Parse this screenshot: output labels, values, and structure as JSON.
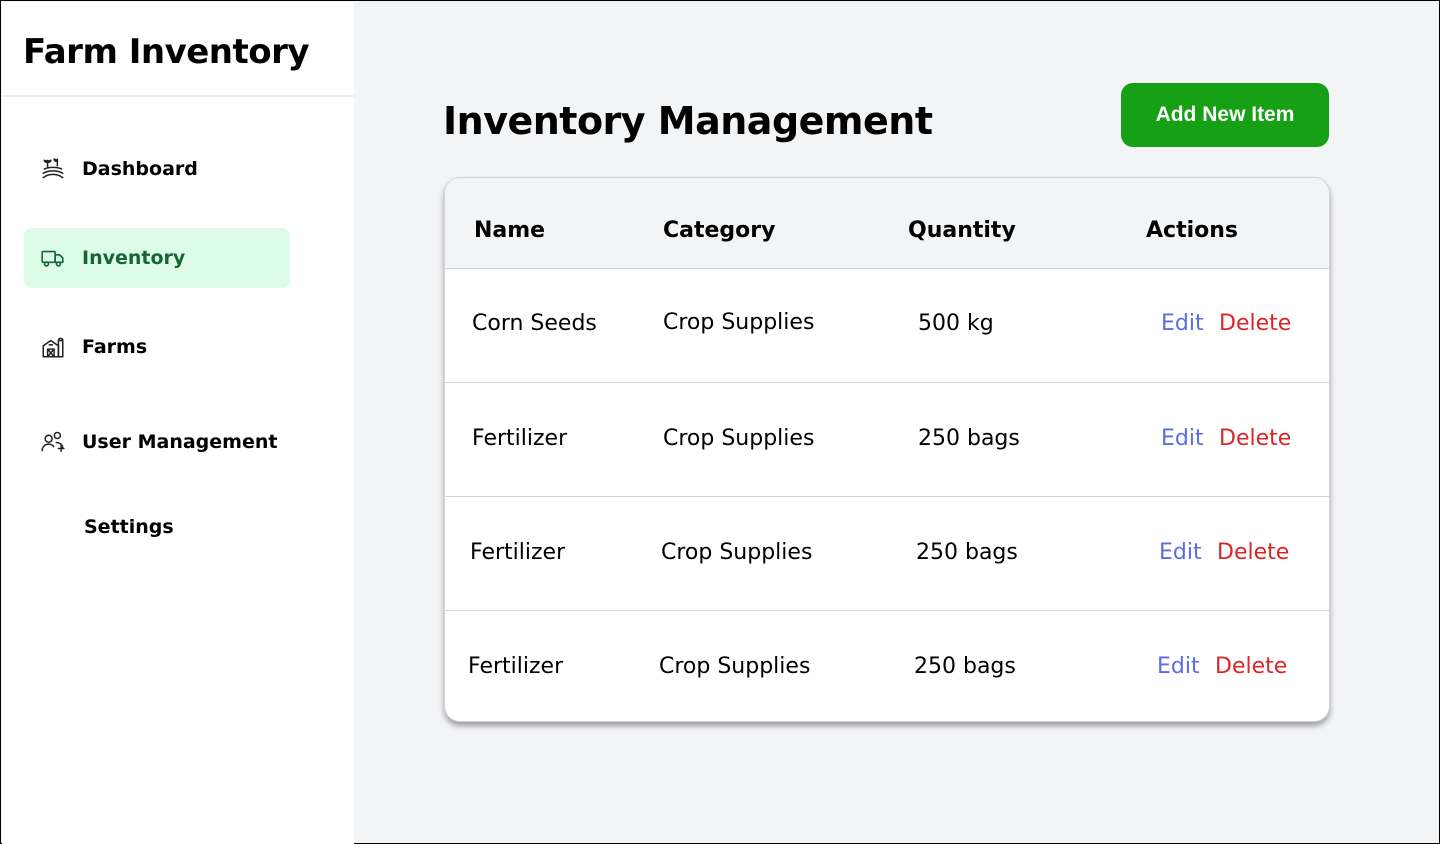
{
  "app": {
    "title": "Farm Inventory"
  },
  "sidebar": {
    "items": [
      {
        "label": "Dashboard",
        "icon": "farm-field-icon",
        "active": false
      },
      {
        "label": "Inventory",
        "icon": "truck-icon",
        "active": true
      },
      {
        "label": "Farms",
        "icon": "barn-icon",
        "active": false
      },
      {
        "label": "User Management",
        "icon": "users-add-icon",
        "active": false
      },
      {
        "label": "Settings",
        "icon": "",
        "active": false
      }
    ]
  },
  "main": {
    "title": "Inventory Management",
    "add_button_label": "Add New Item",
    "table": {
      "headers": [
        "Name",
        "Category",
        "Quantity",
        "Actions"
      ],
      "rows": [
        {
          "name": "Corn Seeds",
          "category": "Crop Supplies",
          "quantity": "500 kg",
          "edit": "Edit",
          "delete": "Delete"
        },
        {
          "name": "Fertilizer",
          "category": "Crop Supplies",
          "quantity": "250 bags",
          "edit": "Edit",
          "delete": "Delete"
        },
        {
          "name": "Fertilizer",
          "category": "Crop Supplies",
          "quantity": "250 bags",
          "edit": "Edit",
          "delete": "Delete"
        },
        {
          "name": "Fertilizer",
          "category": "Crop Supplies",
          "quantity": "250 bags",
          "edit": "Edit",
          "delete": "Delete"
        }
      ]
    }
  },
  "colors": {
    "accent_green": "#16a016",
    "active_bg": "#dcfce7",
    "active_text": "#166534",
    "edit": "#5b6ee1",
    "delete": "#dc2626"
  }
}
